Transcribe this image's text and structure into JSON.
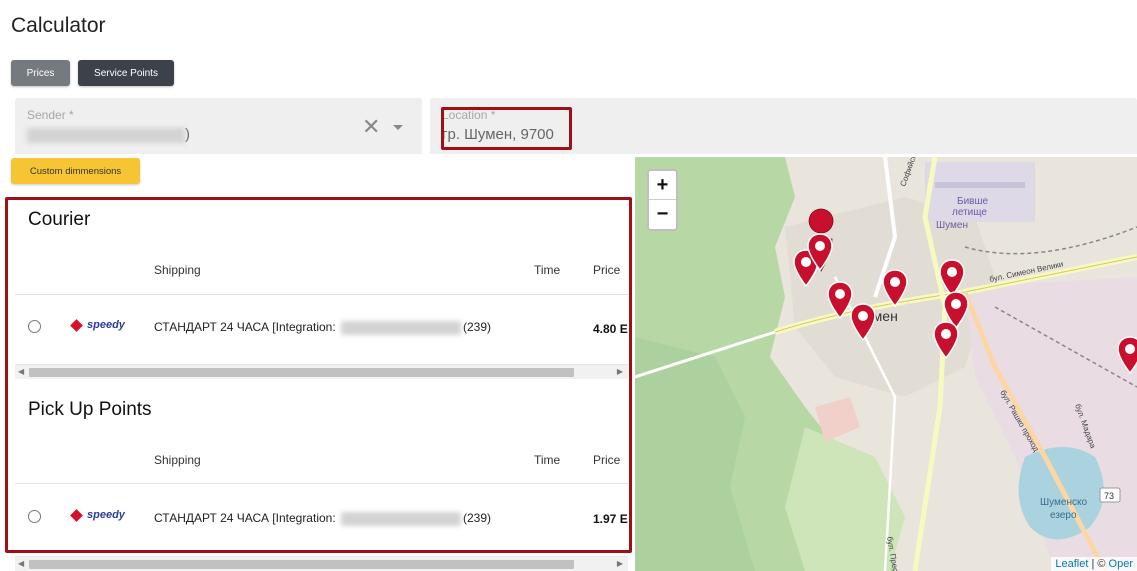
{
  "page_title": "Calculator",
  "tabs": {
    "prices": "Prices",
    "service_points": "Service Points"
  },
  "sender": {
    "label": "Sender *",
    "value_suffix": ")"
  },
  "location": {
    "label": "Location *",
    "value": "гр. Шумен, 9700"
  },
  "custom_dimensions_label": "Custom dimmensions",
  "courier": {
    "title": "Courier",
    "headers": {
      "shipping": "Shipping",
      "time": "Time",
      "price": "Price"
    },
    "row": {
      "carrier": "speedy",
      "service_prefix": "СТАНДАРТ 24 ЧАСА [Integration:",
      "service_suffix": "(239)",
      "price": "4.80 E"
    }
  },
  "pickup": {
    "title": "Pick Up Points",
    "headers": {
      "shipping": "Shipping",
      "time": "Time",
      "price": "Price"
    },
    "row": {
      "carrier": "speedy",
      "service_prefix": "СТАНДАРТ 24 ЧАСА [Integration:",
      "service_suffix": "(239)",
      "price": "1.97 E"
    }
  },
  "map": {
    "zoom_in": "+",
    "zoom_out": "−",
    "city_label": "Шумен",
    "airport_label_1": "Бивше",
    "airport_label_2": "летище",
    "airport_label_3": "Шумен",
    "road_1": "бул. Симеон Велики",
    "road_2": "бул. Рашко проход",
    "road_3": "бул. Мадара",
    "road_4": "Софийско",
    "road_5": "бул. Преслав",
    "lake_1": "Шуменско",
    "lake_2": "езеро",
    "road_number": "73",
    "attribution_link": "Leaflet",
    "attribution_sep": " | © ",
    "attribution_tail": "Oper"
  },
  "colors": {
    "marker": "#c8102e",
    "highlight": "#a00f16",
    "accent": "#f6c533"
  }
}
